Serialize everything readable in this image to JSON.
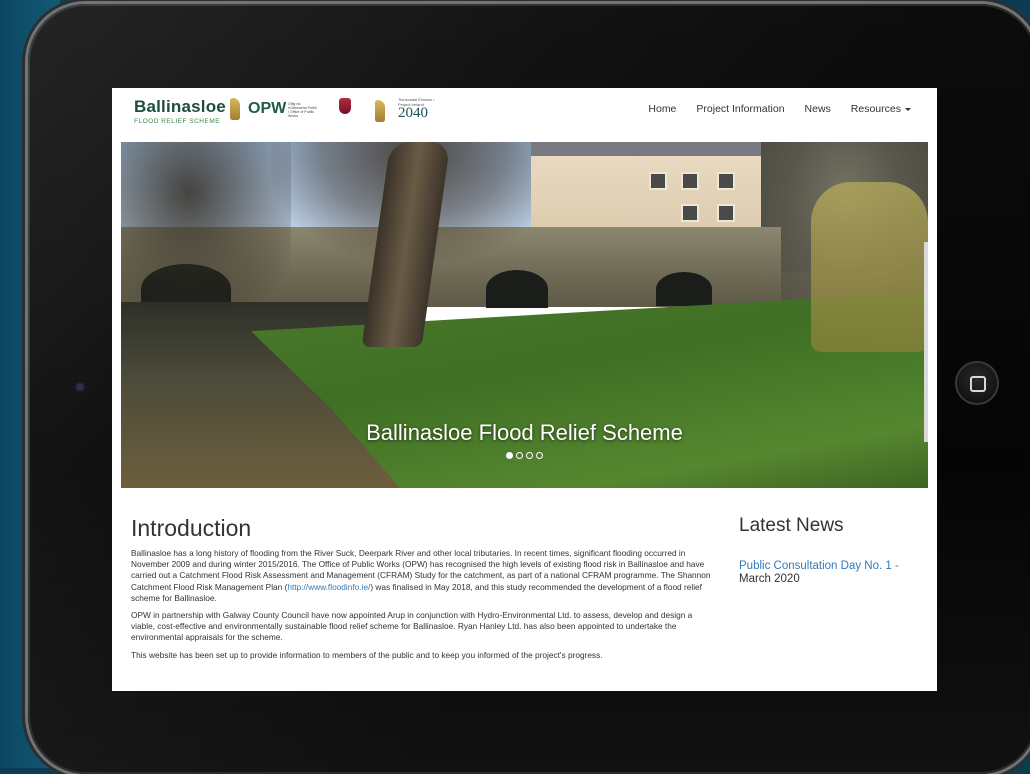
{
  "site": {
    "logo_title": "Ballinasloe",
    "logo_subtitle": "FLOOD RELIEF SCHEME",
    "opw_label": "OPW",
    "opw_subtext": "Oifig na nOibreacha Poiblí / Office of Public Works",
    "tionscadal_small": "Tionscadal Éireann / Project Ireland",
    "tionscadal_year": "2040"
  },
  "nav": {
    "items": [
      {
        "label": "Home"
      },
      {
        "label": "Project Information"
      },
      {
        "label": "News"
      },
      {
        "label": "Resources"
      }
    ]
  },
  "hero": {
    "caption": "Ballinasloe Flood Relief Scheme",
    "slide_count": 4,
    "active_slide": 1
  },
  "intro": {
    "heading": "Introduction",
    "p1_before_link": "Ballinasloe has a long history of flooding from the River Suck, Deerpark River and other local tributaries. In recent times, significant flooding occurred in November 2009 and during winter 2015/2016. The Office of Public Works (OPW) has recognised the high levels of existing flood risk in Ballinasloe and have carried out a Catchment Flood Risk Assessment and Management (CFRAM) Study for the catchment, as part of a national CFRAM programme. The Shannon Catchment Flood Risk Management Plan (",
    "p1_link": "http://www.floodinfo.ie/",
    "p1_after_link": ") was finalised in May 2018, and this study recommended the development of a flood relief scheme for Ballinasloe.",
    "p2": "OPW in partnership with Galway County Council have now appointed Arup in conjunction with Hydro-Environmental Ltd. to assess, develop and design a viable, cost-effective and environmentally sustainable flood relief scheme for Ballinasloe. Ryan Hanley Ltd. has also been appointed to undertake the environmental appraisals for the scheme.",
    "p3": "This website has been set up to provide information to members of the public and to keep you informed of the project's progress."
  },
  "news": {
    "heading": "Latest News",
    "item_title": "Public Consultation Day No. 1 -",
    "item_date": "March 2020"
  },
  "colors": {
    "link": "#337ab7",
    "text": "#333333",
    "background": "#114e66",
    "logo_green": "#1d4f3a"
  },
  "device": {
    "home_button_icon": "square-icon"
  }
}
